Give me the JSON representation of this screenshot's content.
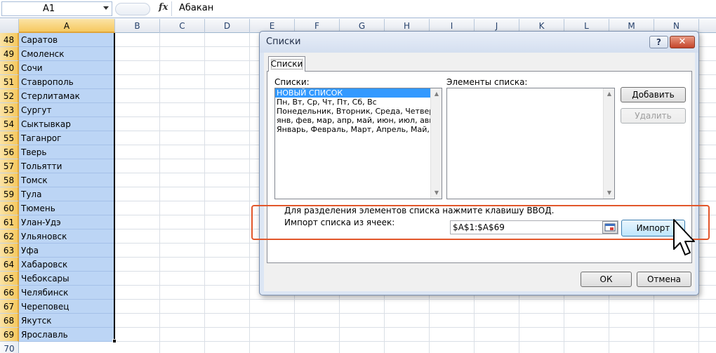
{
  "formula_bar": {
    "name_box": "A1",
    "fx_label": "fx",
    "formula_value": "Абакан"
  },
  "columns": [
    "A",
    "B",
    "C",
    "D",
    "E",
    "F",
    "G",
    "H",
    "I",
    "J",
    "K",
    "L",
    "M",
    "N"
  ],
  "rows": [
    {
      "num": "48",
      "value": "Саратов"
    },
    {
      "num": "49",
      "value": "Смоленск"
    },
    {
      "num": "50",
      "value": "Сочи"
    },
    {
      "num": "51",
      "value": "Ставрополь"
    },
    {
      "num": "52",
      "value": "Стерлитамак"
    },
    {
      "num": "53",
      "value": "Сургут"
    },
    {
      "num": "54",
      "value": "Сыктывкар"
    },
    {
      "num": "55",
      "value": "Таганрог"
    },
    {
      "num": "56",
      "value": "Тверь"
    },
    {
      "num": "57",
      "value": "Тольятти"
    },
    {
      "num": "58",
      "value": "Томск"
    },
    {
      "num": "59",
      "value": "Тула"
    },
    {
      "num": "60",
      "value": "Тюмень"
    },
    {
      "num": "61",
      "value": "Улан-Удэ"
    },
    {
      "num": "62",
      "value": "Ульяновск"
    },
    {
      "num": "63",
      "value": "Уфа"
    },
    {
      "num": "64",
      "value": "Хабаровск"
    },
    {
      "num": "65",
      "value": "Чебоксары"
    },
    {
      "num": "66",
      "value": "Челябинск"
    },
    {
      "num": "67",
      "value": "Череповец"
    },
    {
      "num": "68",
      "value": "Якутск"
    },
    {
      "num": "69",
      "value": "Ярославль"
    },
    {
      "num": "70",
      "value": ""
    }
  ],
  "dialog": {
    "title": "Списки",
    "help_label": "?",
    "close_label": "✕",
    "tab_label": "Списки",
    "lists_label": "Списки:",
    "lists": [
      "НОВЫЙ СПИСОК",
      "Пн, Вт, Ср, Чт, Пт, Сб, Вс",
      "Понедельник, Вторник, Среда, Четверг, Пятница",
      "янв, фев, мар, апр, май, июн, июл, авг, сен",
      "Январь, Февраль, Март, Апрель, Май, Июнь"
    ],
    "entries_label": "Элементы списка:",
    "add_label": "Добавить",
    "delete_label": "Удалить",
    "hint": "Для разделения элементов списка нажмите клавишу ВВОД.",
    "import_label": "Импорт списка из ячеек:",
    "import_range": "$A$1:$A$69",
    "import_button": "Импорт",
    "ok_label": "ОК",
    "cancel_label": "Отмена"
  },
  "colors": {
    "selection_fill": "#bcd5f5",
    "header_selected": "#f6c960",
    "highlight": "#e2572b",
    "dialog_frame": "#dce6f4"
  }
}
